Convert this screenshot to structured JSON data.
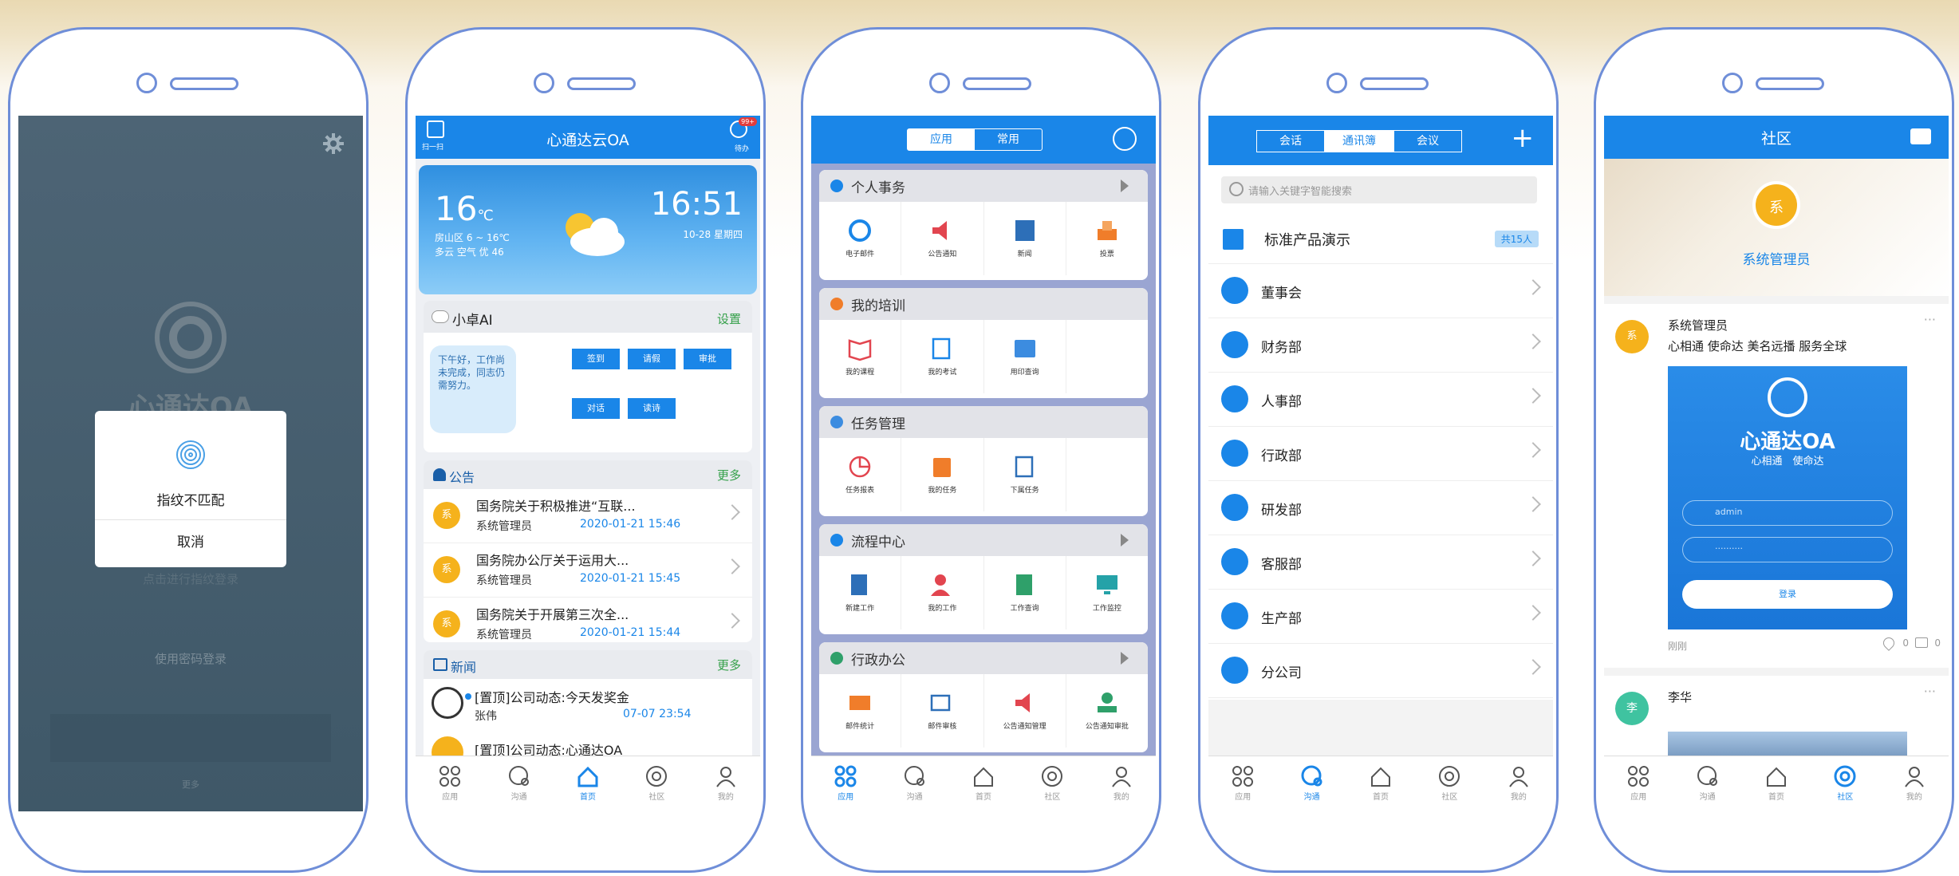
{
  "screen1": {
    "logo_text": "心通达OA",
    "dialog_message": "指纹不匹配",
    "dialog_cancel": "取消",
    "faded_fingerprint_login": "点击进行指纹登录",
    "password_login": "使用密码登录",
    "more": "更多"
  },
  "screen2": {
    "scan_label": "扫一扫",
    "title": "心通达云OA",
    "todo_label": "待办",
    "todo_badge": "99+",
    "weather": {
      "temp": "16",
      "unit": "℃",
      "range": "房山区 6 ~ 16℃",
      "desc": "多云 空气 优 46",
      "time": "16:51",
      "date": "10-28 星期四"
    },
    "ai": {
      "title": "小卓AI",
      "settings": "设置",
      "message": "下午好，工作尚未完成，同志仍需努力。",
      "buttons": [
        "签到",
        "请假",
        "审批",
        "对话",
        "读诗"
      ]
    },
    "notice": {
      "title": "公告",
      "more": "更多",
      "items": [
        {
          "title": "国务院关于积极推进“互联...",
          "author": "系统管理员",
          "time": "2020-01-21 15:46",
          "avatar": "系"
        },
        {
          "title": "国务院办公厅关于运用大...",
          "author": "系统管理员",
          "time": "2020-01-21 15:45",
          "avatar": "系"
        },
        {
          "title": "国务院关于开展第三次全...",
          "author": "系统管理员",
          "time": "2020-01-21 15:44",
          "avatar": "系"
        }
      ]
    },
    "news": {
      "title": "新闻",
      "more": "更多",
      "items": [
        {
          "title": "[置顶]公司动态:今天发奖金",
          "author": "张伟",
          "time": "07-07 23:54"
        },
        {
          "title": "[置顶]公司动态:心通达OA"
        }
      ]
    },
    "tabs": [
      "应用",
      "沟通",
      "首页",
      "社区",
      "我的"
    ]
  },
  "screen3": {
    "seg": [
      "应用",
      "常用"
    ],
    "sections": [
      {
        "title": "个人事务",
        "items": [
          "电子邮件",
          "公告通知",
          "新闻",
          "投票"
        ]
      },
      {
        "title": "我的培训",
        "items": [
          "我的课程",
          "我的考试",
          "用印查询"
        ]
      },
      {
        "title": "任务管理",
        "items": [
          "任务报表",
          "我的任务",
          "下属任务"
        ]
      },
      {
        "title": "流程中心",
        "items": [
          "新建工作",
          "我的工作",
          "工作查询",
          "工作监控"
        ]
      },
      {
        "title": "行政办公",
        "items": [
          "邮件统计",
          "邮件审核",
          "公告通知管理",
          "公告通知审批"
        ]
      }
    ],
    "tabs": [
      "应用",
      "沟通",
      "首页",
      "社区",
      "我的"
    ]
  },
  "screen4": {
    "seg": [
      "会话",
      "通讯簿",
      "会议"
    ],
    "search_placeholder": "请输入关键字智能搜索",
    "org": {
      "name": "标准产品演示",
      "count": "共15人"
    },
    "depts": [
      "董事会",
      "财务部",
      "人事部",
      "行政部",
      "研发部",
      "客服部",
      "生产部",
      "分公司"
    ],
    "tabs": [
      "应用",
      "沟通",
      "首页",
      "社区",
      "我的"
    ]
  },
  "screen5": {
    "title": "社区",
    "admin_name": "系统管理员",
    "admin_avatar": "系",
    "post": {
      "author": "系统管理员",
      "avatar": "系",
      "text": "心相通 使命达 美名远播 服务全球",
      "time": "刚刚",
      "likes": "0",
      "comments": "0"
    },
    "promo": {
      "logo": "心通达OA",
      "slogan": "心相通　使命达",
      "user": "admin",
      "pass": "··········",
      "btn": "登录"
    },
    "post2": {
      "author": "李华",
      "avatar": "李"
    },
    "tabs": [
      "应用",
      "沟通",
      "首页",
      "社区",
      "我的"
    ]
  },
  "colors": {
    "brand_blue": "#1a86e8",
    "orange_avatar": "#f5b21c",
    "phone_outline": "#6f8ed8"
  }
}
